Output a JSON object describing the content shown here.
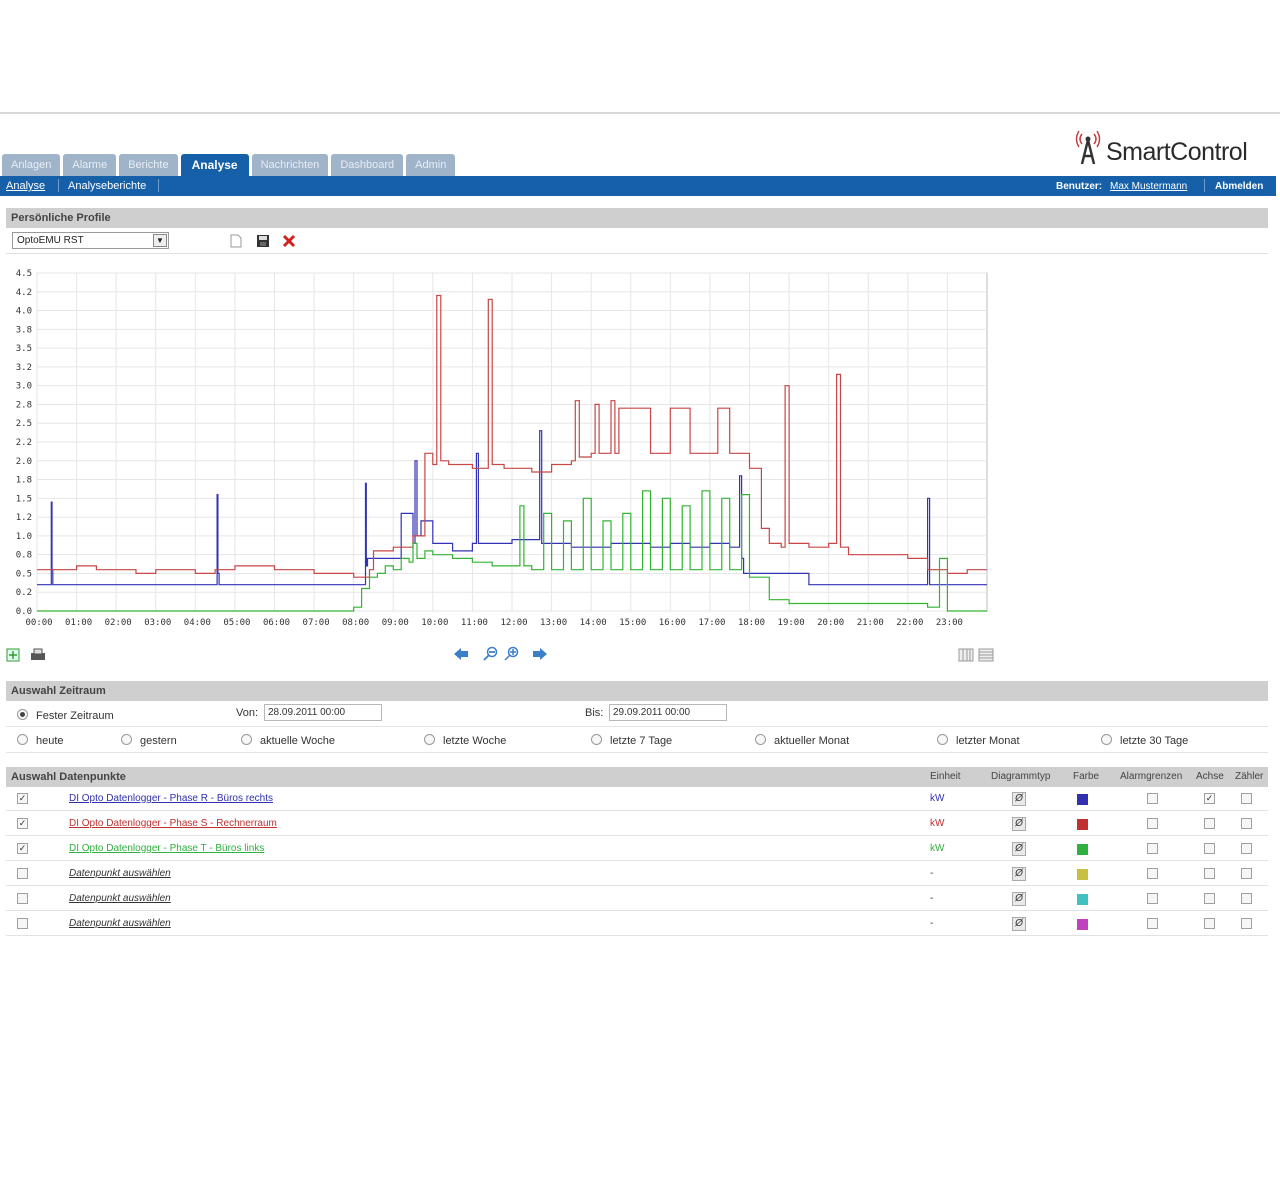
{
  "tabs": [
    {
      "label": "Anlagen"
    },
    {
      "label": "Alarme"
    },
    {
      "label": "Berichte"
    },
    {
      "label": "Analyse"
    },
    {
      "label": "Nachrichten"
    },
    {
      "label": "Dashboard"
    },
    {
      "label": "Admin"
    }
  ],
  "brand": {
    "name": "SmartControl"
  },
  "subnav": {
    "analyse": "Analyse",
    "analyseberichte": "Analyseberichte",
    "benutzer_label": "Benutzer:",
    "benutzer_name": "Max Mustermann",
    "logout": "Abmelden"
  },
  "profile": {
    "section_title": "Persönliche Profile",
    "selected": "OptoEMU RST"
  },
  "period": {
    "section_title": "Auswahl Zeitraum",
    "fixed_label": "Fester Zeitraum",
    "from_label": "Von:",
    "from_value": "28.09.2011 00:00",
    "to_label": "Bis:",
    "to_value": "29.09.2011 00:00",
    "options": [
      "heute",
      "gestern",
      "aktuelle Woche",
      "letzte Woche",
      "letzte 7 Tage",
      "aktueller Monat",
      "letzter Monat",
      "letzte 30 Tage"
    ]
  },
  "datapoints": {
    "section_title": "Auswahl Datenpunkte",
    "headers": {
      "unit": "Einheit",
      "type": "Diagrammtyp",
      "color": "Farbe",
      "alarm": "Alarmgrenzen",
      "axis": "Achse",
      "counter": "Zähler"
    },
    "rows": [
      {
        "label": "DI Opto Datenlogger - Phase R - Büros rechts",
        "unit": "kW",
        "color": "#3030b0",
        "checked": true
      },
      {
        "label": "DI Opto Datenlogger - Phase S - Rechnerraum",
        "unit": "kW",
        "color": "#c03030",
        "checked": true
      },
      {
        "label": "DI Opto Datenlogger - Phase T - Büros links",
        "unit": "kW",
        "color": "#30b040",
        "checked": true
      },
      {
        "label": "Datenpunkt auswählen",
        "unit": "-",
        "color": "#c8c040",
        "checked": false
      },
      {
        "label": "Datenpunkt auswählen",
        "unit": "-",
        "color": "#40c0c0",
        "checked": false
      },
      {
        "label": "Datenpunkt auswählen",
        "unit": "-",
        "color": "#c040c0",
        "checked": false
      }
    ]
  },
  "colors": {
    "accent": "#1560a8",
    "series_r": "#3232b4",
    "series_s": "#c84646",
    "series_t": "#32b432"
  },
  "icons": [
    "new-document-icon",
    "save-icon",
    "delete-icon",
    "export-icon",
    "print-icon",
    "arrow-left-icon",
    "zoom-out-icon",
    "zoom-in-icon",
    "arrow-right-icon",
    "view-list-icon",
    "view-table-icon"
  ],
  "chart_data": {
    "type": "line",
    "title": "",
    "xlabel": "",
    "ylabel": "",
    "x_ticks": [
      "00:00",
      "01:00",
      "02:00",
      "03:00",
      "04:00",
      "05:00",
      "06:00",
      "07:00",
      "08:00",
      "09:00",
      "10:00",
      "11:00",
      "12:00",
      "13:00",
      "14:00",
      "15:00",
      "16:00",
      "17:00",
      "18:00",
      "19:00",
      "20:00",
      "21:00",
      "22:00",
      "23:00"
    ],
    "y_ticks": [
      "0.0",
      "0.2",
      "0.5",
      "0.8",
      "1.0",
      "1.2",
      "1.5",
      "1.8",
      "2.0",
      "2.2",
      "2.5",
      "2.8",
      "3.0",
      "3.2",
      "3.5",
      "3.8",
      "4.0",
      "4.2",
      "4.5"
    ],
    "xlim": [
      0,
      24
    ],
    "ylim": [
      0,
      4.5
    ],
    "grid": true,
    "series": [
      {
        "color": "#3232b4",
        "x": [
          0,
          0.35,
          0.36,
          0.38,
          0.4,
          4.5,
          4.55,
          4.57,
          4.6,
          8.1,
          8.3,
          8.32,
          8.35,
          9.0,
          9.2,
          9.5,
          9.55,
          9.6,
          9.7,
          10.0,
          10.5,
          11.0,
          11.1,
          11.15,
          11.2,
          11.6,
          12.0,
          12.5,
          12.7,
          12.75,
          12.8,
          13.5,
          14.0,
          14.5,
          15.0,
          15.5,
          16.0,
          16.5,
          17.0,
          17.5,
          17.75,
          17.8,
          17.85,
          18.0,
          18.5,
          19.0,
          19.5,
          20.0,
          21.0,
          22.0,
          22.45,
          22.5,
          22.55,
          23.0,
          24.0
        ],
        "y": [
          0.35,
          0.35,
          1.45,
          0.55,
          0.35,
          0.35,
          1.55,
          0.5,
          0.35,
          0.35,
          1.7,
          0.6,
          0.7,
          0.7,
          1.3,
          0.9,
          2.0,
          1.0,
          1.2,
          0.9,
          0.8,
          0.9,
          2.1,
          0.9,
          0.9,
          0.9,
          0.95,
          0.95,
          2.4,
          0.9,
          0.9,
          0.85,
          0.85,
          0.9,
          0.9,
          0.85,
          0.9,
          0.85,
          0.9,
          0.85,
          1.8,
          0.7,
          0.5,
          0.5,
          0.5,
          0.5,
          0.35,
          0.35,
          0.35,
          0.35,
          0.35,
          1.5,
          0.35,
          0.35,
          0.35
        ]
      },
      {
        "color": "#c84646",
        "x": [
          0,
          0.5,
          1.0,
          1.5,
          2.0,
          2.5,
          3.0,
          4.0,
          4.5,
          5.0,
          6.0,
          7.0,
          7.5,
          8.0,
          8.4,
          8.5,
          9.0,
          9.5,
          9.8,
          10.0,
          10.1,
          10.2,
          10.4,
          10.5,
          11.0,
          11.4,
          11.5,
          11.8,
          12.0,
          12.5,
          13.0,
          13.5,
          13.6,
          13.7,
          14.0,
          14.1,
          14.2,
          14.5,
          14.6,
          14.7,
          15.0,
          15.5,
          16.0,
          16.5,
          17.0,
          17.2,
          17.5,
          18.0,
          18.3,
          18.5,
          18.8,
          18.9,
          19.0,
          19.5,
          20.0,
          20.2,
          20.3,
          20.5,
          21.0,
          22.0,
          22.5,
          23.0,
          23.5,
          24.0
        ],
        "y": [
          0.55,
          0.55,
          0.6,
          0.55,
          0.55,
          0.5,
          0.55,
          0.5,
          0.55,
          0.6,
          0.55,
          0.5,
          0.5,
          0.45,
          0.55,
          0.8,
          0.85,
          1.0,
          2.1,
          1.95,
          4.2,
          2.0,
          1.95,
          1.95,
          1.9,
          4.15,
          1.95,
          1.9,
          1.9,
          1.85,
          1.95,
          2.0,
          2.8,
          2.05,
          2.1,
          2.75,
          2.1,
          2.8,
          2.1,
          2.7,
          2.7,
          2.1,
          2.7,
          2.1,
          2.1,
          2.7,
          2.1,
          1.9,
          1.1,
          0.9,
          0.85,
          3.0,
          0.9,
          0.85,
          0.9,
          3.15,
          0.85,
          0.75,
          0.75,
          0.7,
          0.55,
          0.5,
          0.55,
          0.55
        ]
      },
      {
        "color": "#32b432",
        "x": [
          0,
          4.0,
          7.5,
          8.0,
          8.2,
          8.4,
          8.6,
          8.8,
          9.0,
          9.2,
          9.4,
          9.5,
          9.6,
          9.8,
          10.0,
          10.3,
          10.5,
          11.0,
          11.5,
          12.0,
          12.2,
          12.3,
          12.5,
          12.8,
          13.0,
          13.3,
          13.5,
          13.8,
          14.0,
          14.3,
          14.5,
          14.8,
          15.0,
          15.3,
          15.5,
          15.8,
          16.0,
          16.3,
          16.5,
          16.8,
          17.0,
          17.3,
          17.5,
          17.8,
          18.0,
          18.5,
          19.0,
          20.0,
          21.0,
          22.0,
          22.5,
          22.8,
          23.0,
          24.0
        ],
        "y": [
          0.0,
          0.0,
          0.0,
          0.05,
          0.3,
          0.45,
          0.5,
          0.6,
          0.55,
          0.7,
          0.65,
          0.9,
          0.7,
          0.8,
          0.75,
          0.75,
          0.7,
          0.65,
          0.6,
          0.6,
          1.4,
          0.6,
          0.55,
          1.3,
          0.55,
          1.2,
          0.55,
          1.5,
          0.55,
          1.2,
          0.55,
          1.3,
          0.55,
          1.6,
          0.55,
          1.5,
          0.55,
          1.4,
          0.55,
          1.6,
          0.55,
          1.5,
          0.55,
          1.55,
          0.45,
          0.15,
          0.1,
          0.1,
          0.1,
          0.1,
          0.05,
          0.7,
          0.0,
          0.0
        ]
      }
    ]
  }
}
